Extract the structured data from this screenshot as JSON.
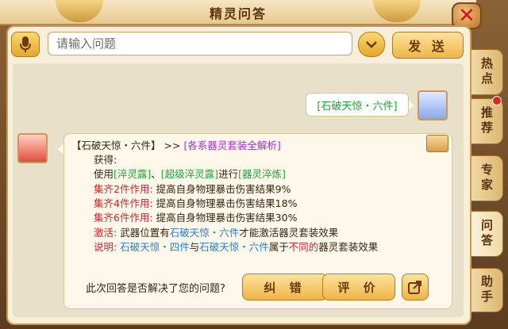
{
  "window": {
    "title": "精灵问答"
  },
  "input": {
    "placeholder": "请输入问题",
    "send_label": "发 送"
  },
  "user_message": "[石破天惊・六件]",
  "answer": {
    "header_item": "【石破天惊・六件】",
    "header_arrows": ">>",
    "header_link": "[各系器灵套装全解析]",
    "obtain_label": "获得:",
    "use_prefix": "使用",
    "use_item1": "[淬灵露]",
    "use_sep": "、",
    "use_item2": "[超级淬灵露]",
    "use_mid": "进行",
    "use_item3": "[器灵淬炼]",
    "set2_label": "集齐2件作用:",
    "set2_text": "提高自身物理暴击伤害结果9%",
    "set4_label": "集齐4件作用:",
    "set4_text": "提高自身物理暴击伤害结果18%",
    "set6_label": "集齐6件作用:",
    "set6_text": "提高自身物理暴击伤害结果30%",
    "activate_label": "激活:",
    "activate_pre": "武器位置有",
    "activate_item": "石破天惊・六件",
    "activate_post": "才能激活器灵套装效果",
    "note_label": "说明:",
    "note_item1": "石破天惊・四件",
    "note_mid": "与",
    "note_item2": "石破天惊・六件",
    "note_pre_diff": "属于",
    "note_diff": "不同的",
    "note_post": "器灵套装效果"
  },
  "feedback": {
    "question": "此次回答是否解决了您的问题?",
    "correct_label": "纠 错",
    "rate_label": "评 价"
  },
  "side_tabs": [
    {
      "label": "热点"
    },
    {
      "label": "推荐"
    },
    {
      "label": "专家"
    },
    {
      "label": "问答"
    },
    {
      "label": "助手"
    }
  ],
  "icons": {
    "mic": "microphone-icon",
    "dropdown": "chevron-down-icon",
    "close": "close-icon",
    "book": "book-icon",
    "share": "share-icon"
  },
  "colors": {
    "accent": "#e7a628",
    "link_green": "#23a13c",
    "link_purple": "#a52fd0",
    "red": "#c8292a",
    "blue": "#2a7ecb"
  }
}
